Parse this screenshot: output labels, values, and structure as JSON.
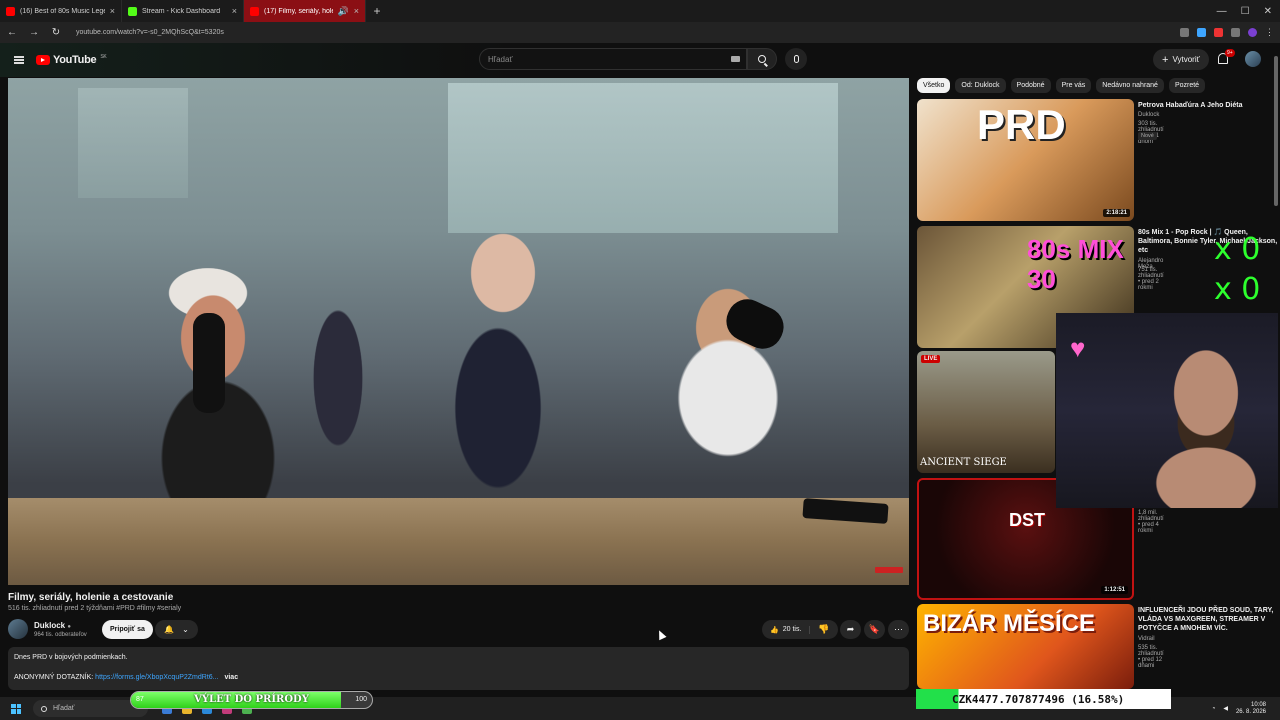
{
  "browser": {
    "tabs": [
      {
        "title": "(16) Best of 80s Music Legends",
        "color": "#ff0000"
      },
      {
        "title": "Stream - Kick Dashboard",
        "color": "#53fc18"
      },
      {
        "title": "(17) Filmy, seriály, holenie a",
        "color": "#ff0000"
      }
    ],
    "url": "youtube.com/watch?v=-s0_2MQhScQ&t=5320s"
  },
  "header": {
    "logo": "YouTube",
    "region": "SK",
    "search_placeholder": "Hľadať",
    "create_label": "Vytvoriť",
    "notifications": "9+"
  },
  "video": {
    "title": "Filmy, seriály, holenie a cestovanie",
    "meta": "516 tis. zhliadnutí  pred 2 týždňami  #PRD #filmy #serialy",
    "channel": "Duklock",
    "subscribers": "964 tis. odberateľov",
    "join_label": "Pripojiť sa",
    "likes": "20 tis.",
    "description_line1": "Dnes PRD v bojových podmienkach.",
    "description_prefix": "ANONYMNÝ DOTAZNÍK:",
    "description_link": "https://forms.gle/XbopXcquP2ZmdRt6...",
    "more_label": "viac"
  },
  "chips": [
    "Všetko",
    "Od: Duklock",
    "Podobné",
    "Pre vás",
    "Nedávno nahrané",
    "Pozreté"
  ],
  "recommendations": [
    {
      "title": "Petrova Habaďúra A Jeho Diéta",
      "channel": "Duklock",
      "meta": "303 tis. zhliadnutí • pred 1 dňom",
      "badge": "Nové",
      "duration": "2:18:21",
      "thumb_text": "PRD"
    },
    {
      "title": "80s Mix 1 - Pop Rock | 🎵 Queen, Baltimora, Bonnie Tyler, Michael Jackson, etc",
      "channel": "Alejandro Meza",
      "meta": "751 tis. zhliadnutí • pred 2 rokmi",
      "thumb_text": "80s MIX 30"
    },
    {
      "title": "",
      "channel": "",
      "meta": "1,8 mil. zhliadnutí • pred 4 rokmi",
      "live": "LIVE",
      "thumb_text": "ANCIENT SIEGE"
    },
    {
      "title": "",
      "channel": "",
      "meta": "",
      "duration": "1:12:51",
      "thumb_text": "DST"
    },
    {
      "title": "INFLUENCEŘI JDOU PŘED SOUD, TARY, VLÁDA VS MAXGREEN, STREAMER V POTYČCE A MNOHEM VÍC.",
      "channel": "Vidrail",
      "meta": "535 tis. zhliadnutí • pred 12 dňami",
      "thumb_text": "BIZÁR MĚSÍCE"
    }
  ],
  "overlay": {
    "counter1": "x 0",
    "counter2": "x 0",
    "goal_label": "VÝLET DO PRÍRODY",
    "goal_min": "87",
    "goal_max": "100",
    "goal_progress": 0.87,
    "czk_text": "CZK4477.707877496 (16.58%)",
    "czk_progress": 0.1658
  },
  "taskbar": {
    "search_placeholder": "Hľadať",
    "time": "10:08",
    "date": "26. 8. 2026"
  },
  "colors": {
    "accent": "#ff0000",
    "link": "#3ea6ff",
    "kick_green": "#53fc18"
  }
}
